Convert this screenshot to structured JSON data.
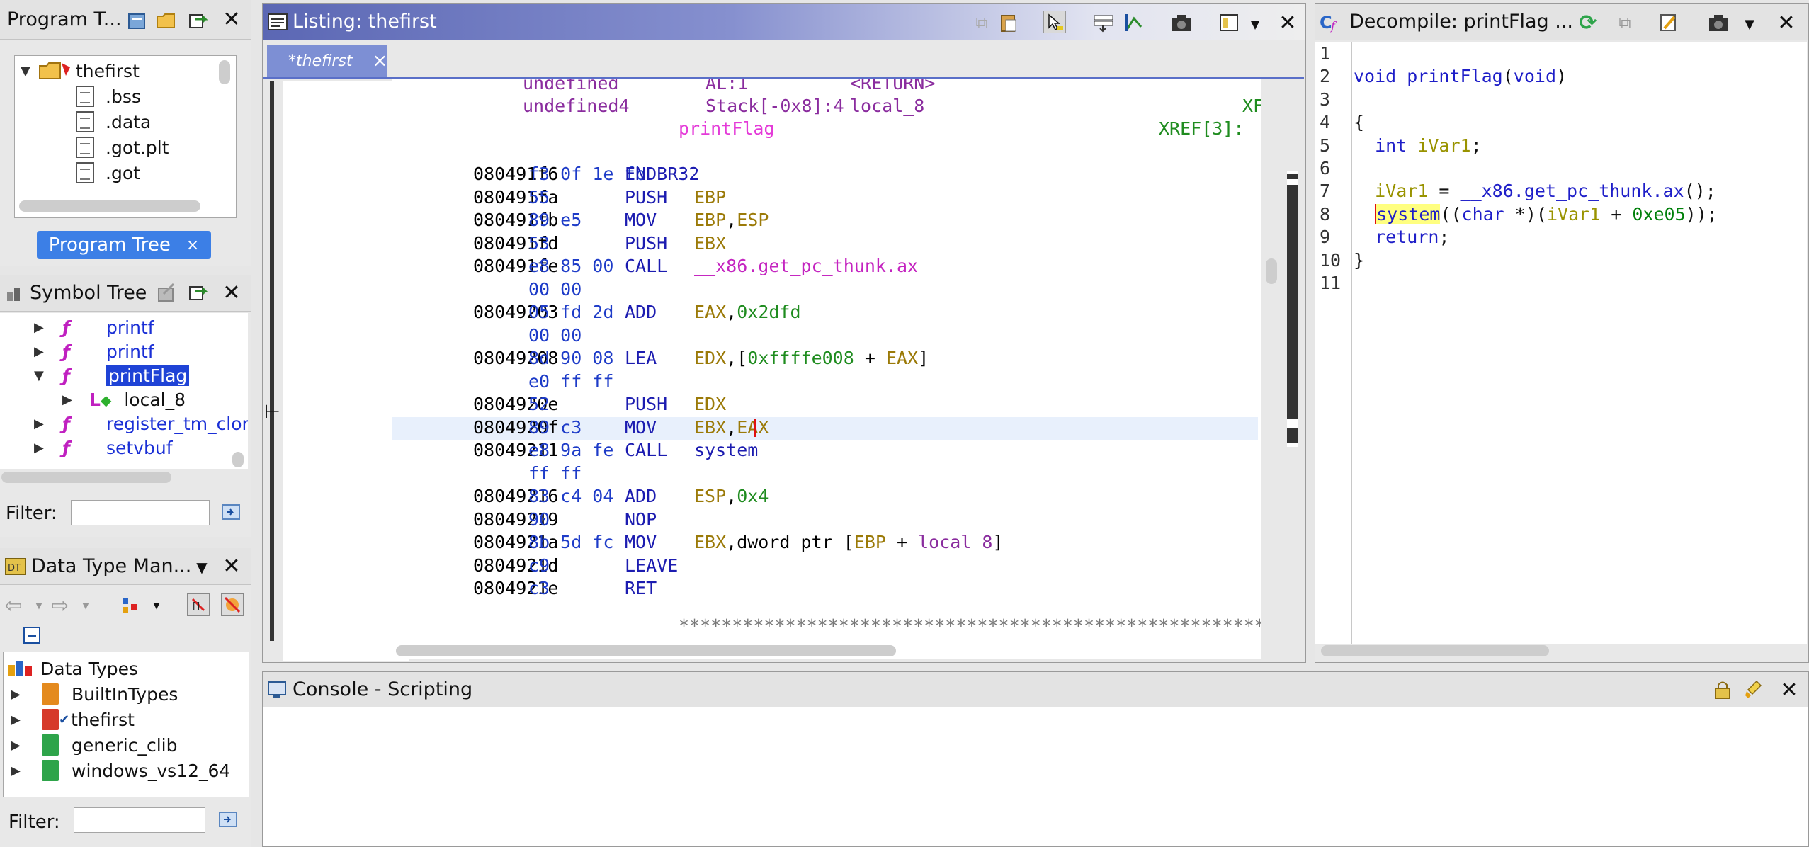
{
  "program_tree": {
    "title": "Program T...",
    "root": "thefirst",
    "items": [
      ".bss",
      ".data",
      ".got.plt",
      ".got"
    ],
    "tab_label": "Program Tree",
    "tab_close": "×"
  },
  "symbol_tree": {
    "title": "Symbol Tree",
    "items": [
      {
        "label": "printf",
        "expanded": false
      },
      {
        "label": "printf",
        "expanded": false
      },
      {
        "label": "printFlag",
        "expanded": true,
        "selected": true
      },
      {
        "label": "local_8",
        "child": true
      },
      {
        "label": "register_tm_clon",
        "expanded": false
      },
      {
        "label": "setvbuf",
        "expanded": false
      }
    ],
    "filter_label": "Filter:"
  },
  "data_type_manager": {
    "title": "Data Type Man...",
    "root": "Data Types",
    "items": [
      "BuiltInTypes",
      "thefirst",
      "generic_clib",
      "windows_vs12_64"
    ],
    "filter_label": "Filter:"
  },
  "listing": {
    "title": "Listing: thefirst",
    "tab": "*thefirst",
    "tab_close": "×",
    "header": {
      "top_type": "undefined",
      "top_storage": "AL:1",
      "top_name": "<RETURN>",
      "type": "undefined4",
      "storage": "Stack[-0x8]:4",
      "name": "local_8",
      "xf": "XF",
      "label": "printFlag",
      "xref": "XREF[3]:"
    },
    "rows": [
      {
        "addr": "080491f6",
        "bytes": "f3 0f 1e fb",
        "mn": "ENDBR32",
        "ops": []
      },
      {
        "addr": "080491fa",
        "bytes": "55",
        "mn": "PUSH",
        "ops": [
          {
            "t": "EBP",
            "c": "reg"
          }
        ]
      },
      {
        "addr": "080491fb",
        "bytes": "89 e5",
        "mn": "MOV",
        "ops": [
          {
            "t": "EBP",
            "c": "reg"
          },
          {
            "t": ",",
            "c": "plain"
          },
          {
            "t": "ESP",
            "c": "reg"
          }
        ]
      },
      {
        "addr": "080491fd",
        "bytes": "53",
        "mn": "PUSH",
        "ops": [
          {
            "t": "EBX",
            "c": "reg"
          }
        ]
      },
      {
        "addr": "080491fe",
        "bytes": "e8 85 00",
        "mn": "CALL",
        "ops": [
          {
            "t": "__x86.get_pc_thunk.ax",
            "c": "func"
          }
        ]
      },
      {
        "addr": "",
        "bytes": "00 00",
        "mn": "",
        "ops": []
      },
      {
        "addr": "08049203",
        "bytes": "05 fd 2d",
        "mn": "ADD",
        "ops": [
          {
            "t": "EAX",
            "c": "reg"
          },
          {
            "t": ",",
            "c": "plain"
          },
          {
            "t": "0x2dfd",
            "c": "xref"
          }
        ]
      },
      {
        "addr": "",
        "bytes": "00 00",
        "mn": "",
        "ops": []
      },
      {
        "addr": "08049208",
        "bytes": "8d 90 08",
        "mn": "LEA",
        "ops": [
          {
            "t": "EDX",
            "c": "reg"
          },
          {
            "t": ",[",
            "c": "plain"
          },
          {
            "t": "0xffffe008",
            "c": "xref"
          },
          {
            "t": " + ",
            "c": "plain"
          },
          {
            "t": "EAX",
            "c": "reg"
          },
          {
            "t": "]",
            "c": "plain"
          }
        ]
      },
      {
        "addr": "",
        "bytes": "e0 ff ff",
        "mn": "",
        "ops": []
      },
      {
        "addr": "0804920e",
        "bytes": "52",
        "mn": "PUSH",
        "ops": [
          {
            "t": "EDX",
            "c": "reg"
          }
        ]
      },
      {
        "addr": "0804920f",
        "bytes": "89 c3",
        "mn": "MOV",
        "ops": [
          {
            "t": "EBX",
            "c": "reg"
          },
          {
            "t": ",",
            "c": "plain"
          },
          {
            "t": "EAX",
            "c": "reg"
          }
        ],
        "current": true
      },
      {
        "addr": "08049211",
        "bytes": "e8 9a fe",
        "mn": "CALL",
        "ops": [
          {
            "t": "system",
            "c": "mn"
          }
        ]
      },
      {
        "addr": "",
        "bytes": "ff ff",
        "mn": "",
        "ops": []
      },
      {
        "addr": "08049216",
        "bytes": "83 c4 04",
        "mn": "ADD",
        "ops": [
          {
            "t": "ESP",
            "c": "reg"
          },
          {
            "t": ",",
            "c": "plain"
          },
          {
            "t": "0x4",
            "c": "xref"
          }
        ]
      },
      {
        "addr": "08049219",
        "bytes": "90",
        "mn": "NOP",
        "ops": []
      },
      {
        "addr": "0804921a",
        "bytes": "8b 5d fc",
        "mn": "MOV",
        "ops": [
          {
            "t": "EBX",
            "c": "reg"
          },
          {
            "t": ",dword ptr [",
            "c": "plain"
          },
          {
            "t": "EBP",
            "c": "reg"
          },
          {
            "t": " + ",
            "c": "plain"
          },
          {
            "t": "local_8",
            "c": "local"
          },
          {
            "t": "]",
            "c": "plain"
          }
        ]
      },
      {
        "addr": "0804921d",
        "bytes": "c9",
        "mn": "LEAVE",
        "ops": []
      },
      {
        "addr": "0804921e",
        "bytes": "c3",
        "mn": "RET",
        "ops": []
      }
    ],
    "separator": "*****************************************************************"
  },
  "decompile": {
    "title": "Decompile: printFlag ...",
    "lines": [
      {
        "n": "1",
        "toks": []
      },
      {
        "n": "2",
        "toks": [
          {
            "t": "void ",
            "c": "kw"
          },
          {
            "t": "printFlag",
            "c": "fn"
          },
          {
            "t": "(",
            "c": "plain"
          },
          {
            "t": "void",
            "c": "kw"
          },
          {
            "t": ")",
            "c": "plain"
          }
        ]
      },
      {
        "n": "3",
        "toks": []
      },
      {
        "n": "4",
        "toks": [
          {
            "t": "{",
            "c": "plain"
          }
        ]
      },
      {
        "n": "5",
        "toks": [
          {
            "t": "  ",
            "c": "plain"
          },
          {
            "t": "int ",
            "c": "kw"
          },
          {
            "t": "iVar1",
            "c": "var"
          },
          {
            "t": ";",
            "c": "plain"
          }
        ]
      },
      {
        "n": "6",
        "toks": []
      },
      {
        "n": "7",
        "toks": [
          {
            "t": "  ",
            "c": "plain"
          },
          {
            "t": "iVar1",
            "c": "var"
          },
          {
            "t": " = ",
            "c": "plain"
          },
          {
            "t": "__x86.get_pc_thunk.ax",
            "c": "fn"
          },
          {
            "t": "();",
            "c": "plain"
          }
        ]
      },
      {
        "n": "8",
        "toks": [
          {
            "t": "  ",
            "c": "plain"
          },
          {
            "t": "system",
            "c": "fn",
            "hl": true
          },
          {
            "t": "((",
            "c": "plain"
          },
          {
            "t": "char",
            "c": "kw"
          },
          {
            "t": " *)(",
            "c": "plain"
          },
          {
            "t": "iVar1",
            "c": "var"
          },
          {
            "t": " + ",
            "c": "plain"
          },
          {
            "t": "0xe05",
            "c": "num"
          },
          {
            "t": "));",
            "c": "plain"
          }
        ]
      },
      {
        "n": "9",
        "toks": [
          {
            "t": "  ",
            "c": "plain"
          },
          {
            "t": "return",
            "c": "kw"
          },
          {
            "t": ";",
            "c": "plain"
          }
        ]
      },
      {
        "n": "10",
        "toks": [
          {
            "t": "}",
            "c": "plain"
          }
        ]
      },
      {
        "n": "11",
        "toks": []
      }
    ]
  },
  "console": {
    "title": "Console - Scripting"
  },
  "colors": {
    "listing_title_bg": "#5b67b4",
    "selection": "#1f43d6",
    "current_line": "#e8f0fc",
    "highlight": "#ffff80"
  }
}
